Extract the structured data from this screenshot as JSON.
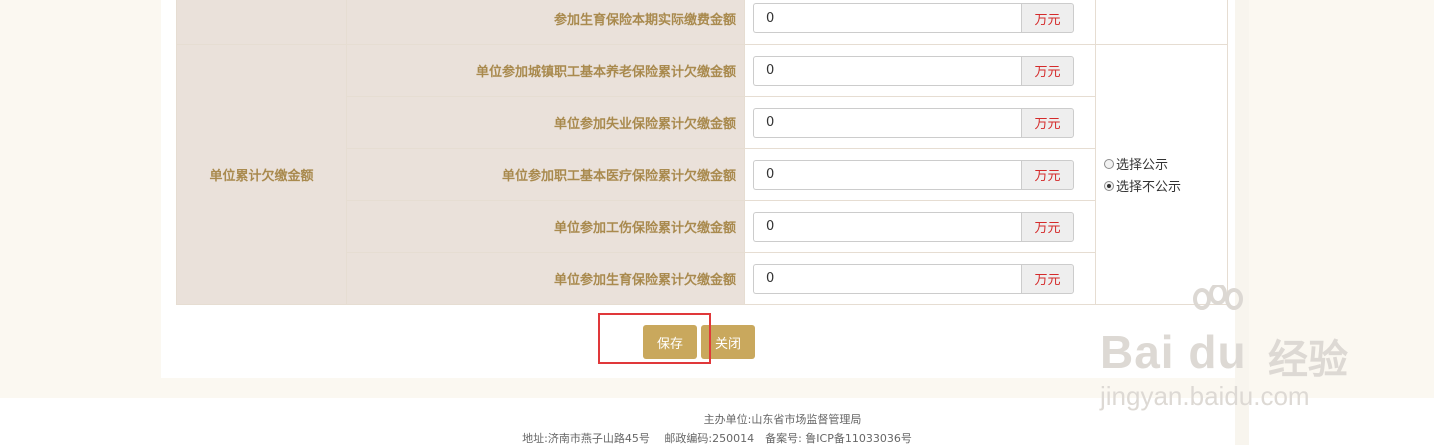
{
  "rows": [
    {
      "label": "参加生育保险本期实际缴费金额",
      "value": "0",
      "unit": "万元"
    },
    {
      "label": "单位参加城镇职工基本养老保险累计欠缴金额",
      "value": "0",
      "unit": "万元"
    },
    {
      "label": "单位参加失业保险累计欠缴金额",
      "value": "0",
      "unit": "万元"
    },
    {
      "label": "单位参加职工基本医疗保险累计欠缴金额",
      "value": "0",
      "unit": "万元"
    },
    {
      "label": "单位参加工伤保险累计欠缴金额",
      "value": "0",
      "unit": "万元"
    },
    {
      "label": "单位参加生育保险累计欠缴金额",
      "value": "0",
      "unit": "万元"
    }
  ],
  "group_label": "单位累计欠缴金额",
  "publish": {
    "option_public": "选择公示",
    "option_private": "选择不公示",
    "selected": "选择不公示"
  },
  "buttons": {
    "save": "保存",
    "close": "关闭"
  },
  "footer": {
    "host": "主办单位:山东省市场监督管理局",
    "address": "地址:济南市燕子山路45号　 邮政编码:250014　备案号: 鲁ICP备11033036号"
  },
  "watermark": {
    "brand": "Bai du",
    "brand_cn": "经验",
    "url": "jingyan.baidu.com"
  },
  "colors": {
    "label_bg": "#eae1da",
    "label_text": "#a98a4e",
    "button": "#c9a85d",
    "unit_text": "#d42a2a",
    "highlight": "#e0383a"
  }
}
